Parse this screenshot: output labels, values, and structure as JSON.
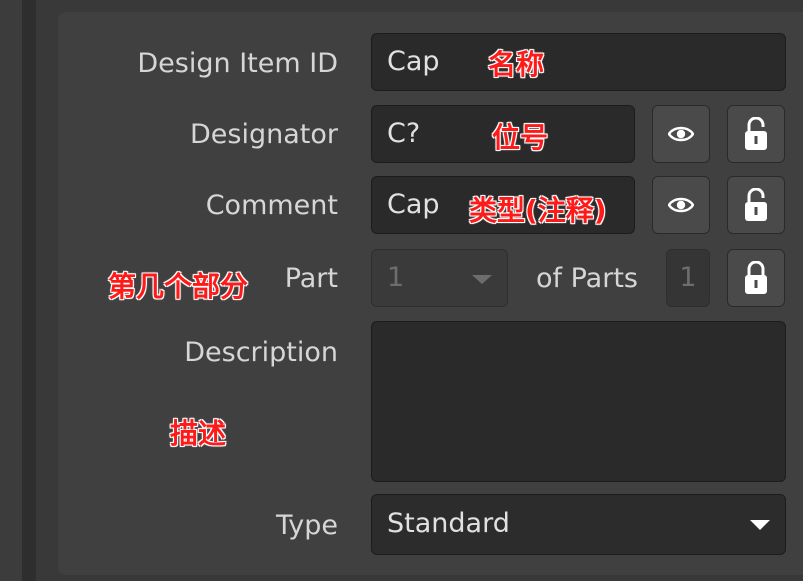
{
  "form": {
    "design_item_id": {
      "label": "Design Item ID",
      "value": "Cap"
    },
    "designator": {
      "label": "Designator",
      "value": "C?"
    },
    "comment": {
      "label": "Comment",
      "value": "Cap"
    },
    "part": {
      "label": "Part",
      "value": "1",
      "of_parts_label": "of Parts",
      "of_parts_value": "1"
    },
    "description": {
      "label": "Description",
      "value": ""
    },
    "type": {
      "label": "Type",
      "value": "Standard"
    }
  },
  "annotations": {
    "design_item_id": "名称",
    "designator": "位号",
    "comment": "类型(注释)",
    "part": "第几个部分",
    "description": "描述"
  },
  "icons": {
    "visibility": "eye-icon",
    "lock_open": "unlocked-padlock-icon",
    "lock_closed": "locked-padlock-icon",
    "dropdown": "chevron-down-icon"
  },
  "colors": {
    "annotation_red": "#ff1a1a",
    "panel_bg": "#404040",
    "field_bg": "#2a2a2a"
  }
}
